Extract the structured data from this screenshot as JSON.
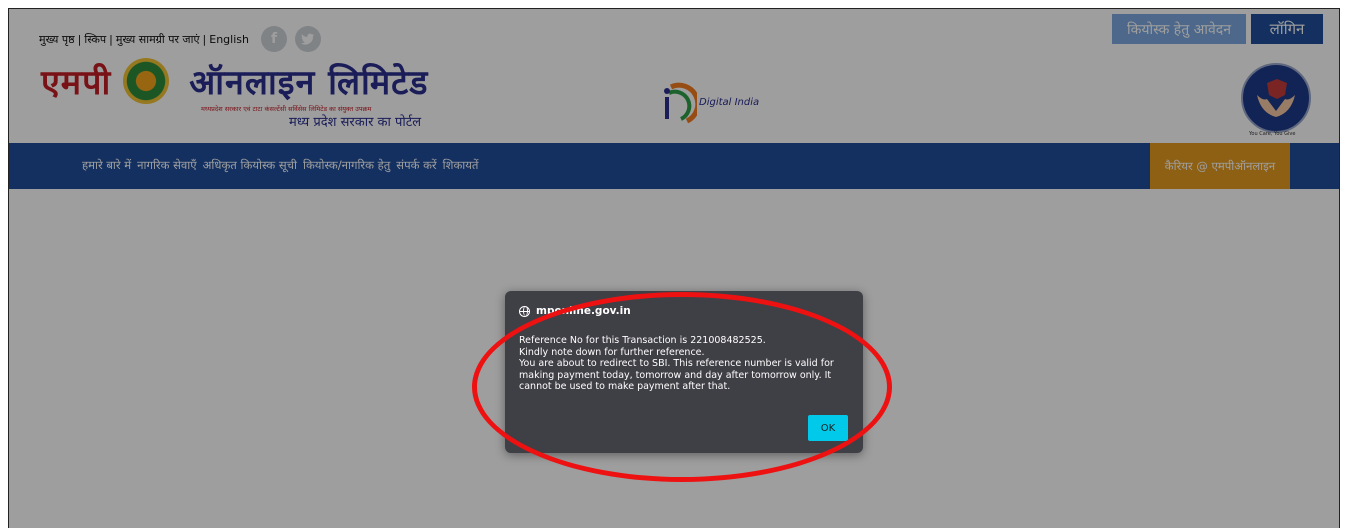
{
  "header": {
    "top_links": [
      "मुख्य पृष्ठ",
      "स्किप",
      "मुख्य सामग्री पर जाएं",
      "English"
    ],
    "separator": "|",
    "kiosk_button": "कियोस्क हेतु आवेदन",
    "login_button": "लॉगिन"
  },
  "logo": {
    "title_part1": "एमपी",
    "title_part2": "ऑनलाइन लिमिटेड",
    "subtitle_small": "मध्यप्रदेश सरकार एवं टाटा कंसल्टेंसी सर्विसेस लिमिटेड का संयुक्त उपक्रम",
    "subtitle": "मध्य प्रदेश सरकार का पोर्टल",
    "digital_india": "Digital India",
    "seal_caption": "You Care, You Give"
  },
  "nav": {
    "items": [
      "हमारे बारे में",
      "नागरिक सेवाएँ",
      "अधिकृत कियोस्क सूची",
      "कियोस्क/नागरिक हेतु",
      "संपर्क करें",
      "शिकायतें"
    ],
    "career": "कैरियर @ एमपीऑनलाइन"
  },
  "dialog": {
    "site": "mponline.gov.in",
    "lines": [
      "Reference No for this Transaction is 221008482525.",
      "Kindly note down for further reference.",
      "You are about to redirect to SBI. This reference number is valid for",
      "making payment today, tomorrow and day after tomorrow only. It",
      "cannot be used to make payment after that."
    ],
    "ok_label": "OK"
  },
  "colors": {
    "nav_bg": "#1f4e9c",
    "career_bg": "#e59b1f",
    "dialog_bg": "#3f3f46",
    "ok_bg": "#00c9ea",
    "annotation": "#ee1111"
  }
}
